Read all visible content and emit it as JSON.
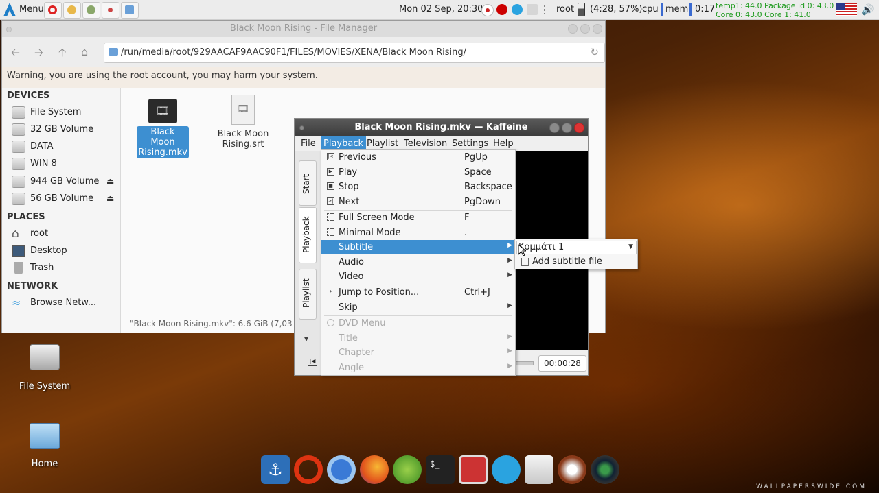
{
  "panel": {
    "menu_label": "Menu",
    "clock": "Mon 02 Sep, 20:30",
    "user": "root",
    "battery": "(4:28, 57%)",
    "cpu_label": "cpu",
    "mem_label": "mem",
    "uptime": "0:17",
    "temp_line1": "temp1: 44.0   Package id 0: 43.0",
    "temp_line2": "Core 0: 43.0   Core 1: 41.0",
    "icons": [
      "app-menu-icon",
      "opera-icon",
      "chromium-icon",
      "chrome-icon",
      "kaffeine-icon",
      "file-manager-icon"
    ],
    "tray_icons": [
      "record-icon",
      "opera-tray-icon",
      "telegram-icon",
      "network-icon",
      "battery-icon",
      "flag-icon",
      "volume-icon"
    ]
  },
  "file_manager": {
    "title": "Black Moon Rising - File Manager",
    "address": "/run/media/root/929AACAF9AAC90F1/FILES/MOVIES/XENA/Black Moon Rising/",
    "warning": "Warning, you are using the root account, you may harm your system.",
    "sections": {
      "devices": "DEVICES",
      "places": "PLACES",
      "network": "NETWORK"
    },
    "devices": [
      "File System",
      "32 GB Volume",
      "DATA",
      "WIN 8",
      "944 GB Volume",
      "56 GB Volume"
    ],
    "places": [
      "root",
      "Desktop",
      "Trash"
    ],
    "network": [
      "Browse Netw..."
    ],
    "files": [
      {
        "name_line1": "Black Moon",
        "name_line2": "Rising.mkv"
      },
      {
        "name_line1": "Black Moon",
        "name_line2": "Rising.srt"
      }
    ],
    "status": "\"Black Moon Rising.mkv\": 6.6 GiB (7,03"
  },
  "kaffeine": {
    "title": "Black Moon Rising.mkv — Kaffeine",
    "menubar": [
      "File",
      "Playback",
      "Playlist",
      "Television",
      "Settings",
      "Help"
    ],
    "side_tabs": [
      "Start",
      "Playback",
      "Playlist"
    ],
    "time": "00:00:28"
  },
  "playback_menu": {
    "items": [
      {
        "label": "Previous",
        "shortcut": "PgUp"
      },
      {
        "label": "Play",
        "shortcut": "Space"
      },
      {
        "label": "Stop",
        "shortcut": "Backspace"
      },
      {
        "label": "Next",
        "shortcut": "PgDown"
      },
      {
        "label": "Full Screen Mode",
        "shortcut": "F"
      },
      {
        "label": "Minimal Mode",
        "shortcut": "."
      },
      {
        "label": "Subtitle"
      },
      {
        "label": "Audio"
      },
      {
        "label": "Video"
      },
      {
        "label": "Jump to Position...",
        "shortcut": "Ctrl+J"
      },
      {
        "label": "Skip"
      },
      {
        "label": "DVD Menu"
      },
      {
        "label": "Title"
      },
      {
        "label": "Chapter"
      },
      {
        "label": "Angle"
      }
    ]
  },
  "subtitle_menu": {
    "selected": "Κομμάτι 1",
    "add_label": "Add subtitle file"
  },
  "desktop": {
    "icons": [
      "File System",
      "Home"
    ]
  },
  "watermark": "WALLPAPERSWIDE.COM",
  "colors": {
    "accent": "#3d8fd1",
    "temp_text": "#1c9a1c",
    "window_title_dark": "#3b3b3b"
  }
}
